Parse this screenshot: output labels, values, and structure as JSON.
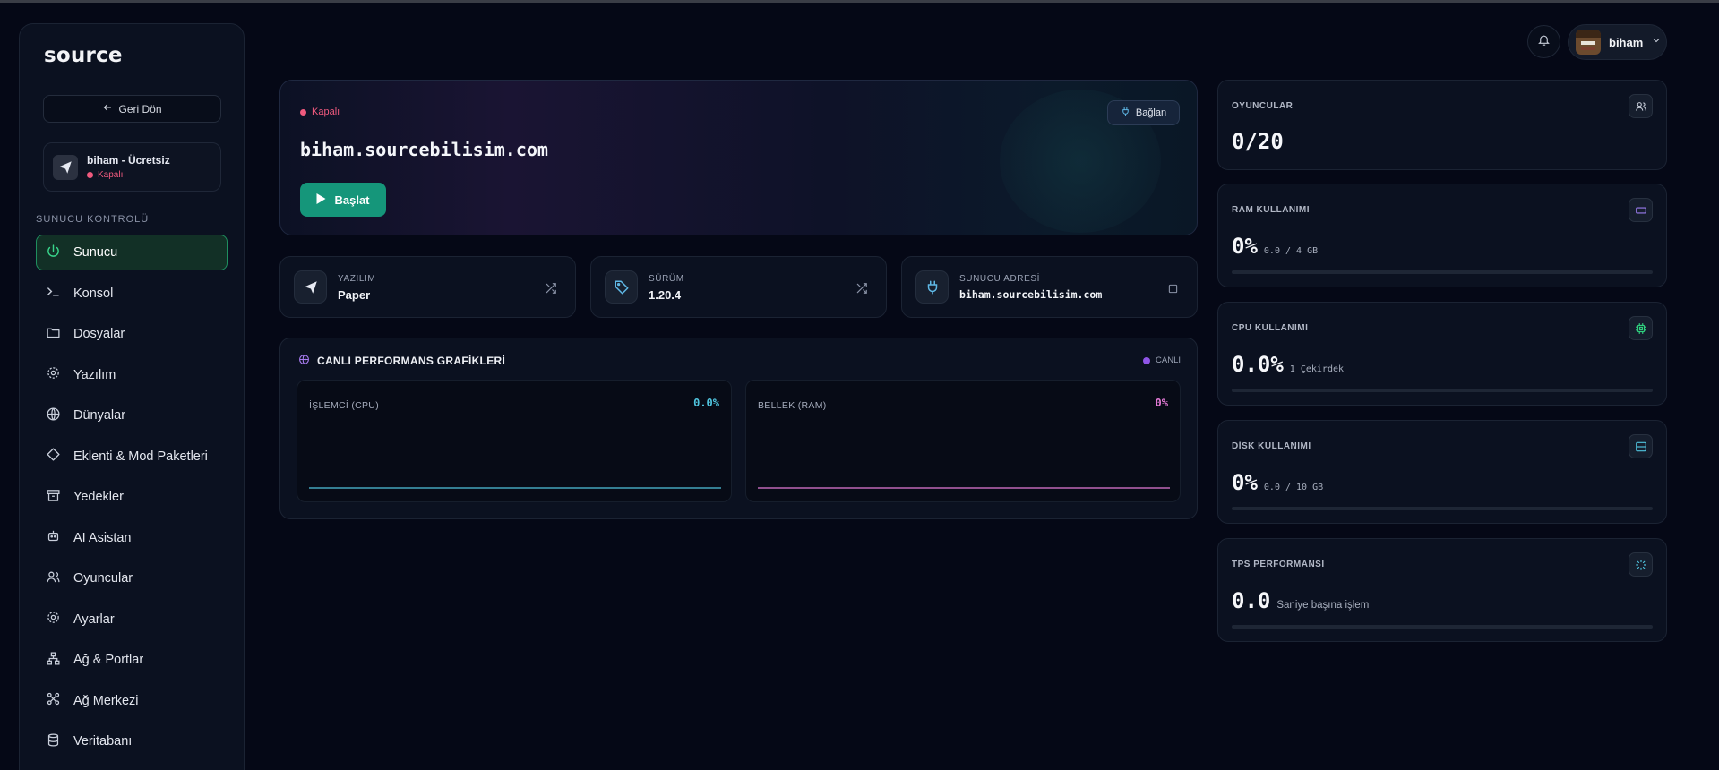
{
  "sidebar": {
    "logo": "source",
    "back_label": "Geri Dön",
    "server": {
      "name": "biham - Ücretsiz",
      "status": "Kapalı"
    },
    "section_label": "SUNUCU KONTROLÜ",
    "items": [
      {
        "label": "Sunucu",
        "icon": "power-icon",
        "active": true
      },
      {
        "label": "Konsol",
        "icon": "terminal-icon"
      },
      {
        "label": "Dosyalar",
        "icon": "folder-icon"
      },
      {
        "label": "Yazılım",
        "icon": "gear-icon"
      },
      {
        "label": "Dünyalar",
        "icon": "globe-icon"
      },
      {
        "label": "Eklenti & Mod Paketleri",
        "icon": "puzzle-icon"
      },
      {
        "label": "Yedekler",
        "icon": "archive-icon"
      },
      {
        "label": "AI Asistan",
        "icon": "robot-icon"
      },
      {
        "label": "Oyuncular",
        "icon": "users-icon"
      },
      {
        "label": "Ayarlar",
        "icon": "settings-icon"
      },
      {
        "label": "Ağ & Portlar",
        "icon": "network-icon"
      },
      {
        "label": "Ağ Merkezi",
        "icon": "hub-icon"
      },
      {
        "label": "Veritabanı",
        "icon": "database-icon"
      }
    ]
  },
  "header": {
    "user_name": "biham"
  },
  "hero": {
    "status": "Kapalı",
    "address": "biham.sourcebilisim.com",
    "start_label": "Başlat",
    "connect_label": "Bağlan"
  },
  "info": {
    "software": {
      "label": "YAZILIM",
      "value": "Paper"
    },
    "version": {
      "label": "SÜRÜM",
      "value": "1.20.4"
    },
    "address": {
      "label": "SUNUCU ADRESİ",
      "value": "biham.sourcebilisim.com"
    }
  },
  "performance": {
    "title": "CANLI PERFORMANS GRAFİKLERİ",
    "live_label": "CANLI",
    "cpu": {
      "label": "İŞLEMCİ (CPU)",
      "value": "0.0%",
      "color": "#4fc3dd"
    },
    "ram": {
      "label": "BELLEK (RAM)",
      "value": "0%",
      "color": "#e37ad6"
    }
  },
  "stats": {
    "players": {
      "label": "OYUNCULAR",
      "value": "0/20"
    },
    "ram": {
      "label": "RAM KULLANIMI",
      "value": "0%",
      "sub": "0.0 / 4 GB",
      "fraction": 0
    },
    "cpu": {
      "label": "CPU KULLANIMI",
      "value": "0.0%",
      "sub": "1 Çekirdek",
      "fraction": 0
    },
    "disk": {
      "label": "DİSK KULLANIMI",
      "value": "0%",
      "sub": "0.0 / 10 GB",
      "fraction": 0
    },
    "tps": {
      "label": "TPS PERFORMANSI",
      "value": "0.0",
      "sub": "Saniye başına işlem",
      "fraction": 0
    }
  },
  "colors": {
    "accent": "#15967a",
    "offline": "#f05a7e",
    "live": "#8f55e6"
  }
}
